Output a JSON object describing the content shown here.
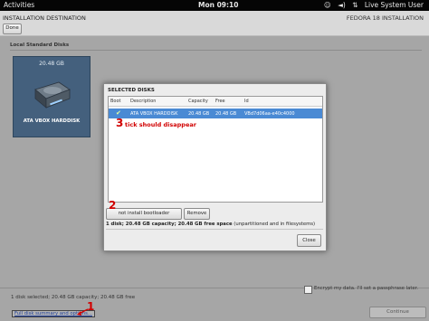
{
  "topbar": {
    "activities": "Activities",
    "clock": "Mon 09:10",
    "session": "Live System User",
    "icons": [
      "accessibility-icon",
      "volume-icon",
      "network-icon",
      "user-icon"
    ]
  },
  "header": {
    "title": "INSTALLATION DESTINATION",
    "product": "FEDORA 18 INSTALLATION",
    "done_label": "Done"
  },
  "local_disks": {
    "section_label": "Local Standard Disks",
    "disk": {
      "size": "20.48 GB",
      "name": "ATA VBOX HARDDISK"
    }
  },
  "dialog": {
    "title": "SELECTED DISKS",
    "columns": [
      "Boot",
      "Description",
      "Capacity",
      "Free",
      "Id"
    ],
    "rows": [
      {
        "boot": "✔",
        "description": "ATA VBOX HARDDISK",
        "capacity": "20.48 GB",
        "free": "20.48 GB",
        "id": "VBd7d06aa-e40c4000"
      }
    ],
    "no_bootloader_label": "not install bootloader",
    "remove_label": "Remove",
    "summary_bold": "1 disk; 20.48 GB capacity; 20.48 GB free space",
    "summary_rest": " (unpartitioned and in filesystems)",
    "close_label": "Close"
  },
  "footer": {
    "status": "1 disk selected; 20.48 GB capacity; 20.48 GB free",
    "summary_link": "Full disk summary and options...",
    "encrypt_label": "Encrypt my data. I'll set a passphrase later.",
    "continue_label": "Continue"
  },
  "annotations": {
    "one": "1",
    "two": "2",
    "three": "3",
    "three_text": "tick should disappear"
  },
  "colors": {
    "annotation": "#d10000",
    "selection": "#4a8ad4",
    "disk_tile": "#44607d"
  }
}
